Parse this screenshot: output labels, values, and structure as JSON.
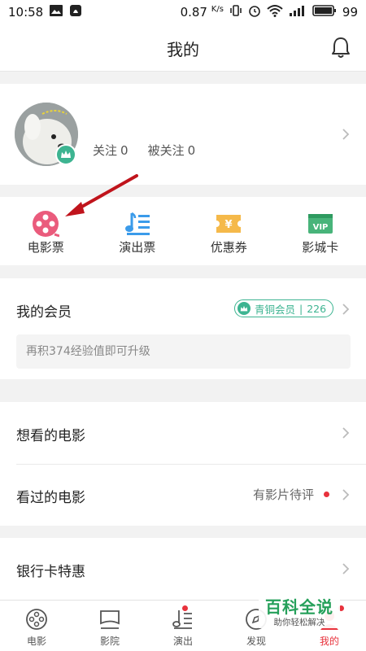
{
  "status_bar": {
    "time": "10:58",
    "speed": "0.87",
    "speed_unit": "K/s",
    "battery": "99"
  },
  "header": {
    "title": "我的"
  },
  "profile": {
    "follow_label": "关注",
    "follow_count": "0",
    "followers_label": "被关注",
    "followers_count": "0"
  },
  "quick_actions": [
    {
      "label": "电影票",
      "icon": "movie-ticket-icon",
      "color": "#ea5b7c"
    },
    {
      "label": "演出票",
      "icon": "show-ticket-icon",
      "color": "#3b9bea"
    },
    {
      "label": "优惠券",
      "icon": "coupon-icon",
      "color": "#f5b94a"
    },
    {
      "label": "影城卡",
      "icon": "vip-card-icon",
      "color": "#48b47a"
    }
  ],
  "membership": {
    "title": "我的会员",
    "level": "青铜会员",
    "points": "226",
    "hint": "再积374经验值即可升级"
  },
  "lists": {
    "want_to_watch": "想看的电影",
    "watched": "看过的电影",
    "pending_review": "有影片待评",
    "bank_card": "银行卡特惠"
  },
  "tabs": [
    {
      "label": "电影",
      "icon": "film-reel-icon",
      "active": false
    },
    {
      "label": "影院",
      "icon": "cinema-screen-icon",
      "active": false
    },
    {
      "label": "演出",
      "icon": "music-note-icon",
      "active": false,
      "dot": true
    },
    {
      "label": "发现",
      "icon": "discover-icon",
      "active": false
    },
    {
      "label": "我的",
      "icon": "profile-icon",
      "active": true,
      "dot": true
    }
  ],
  "watermark": {
    "title": "百科全说",
    "subtitle": "助你轻松解决"
  },
  "colors": {
    "accent": "#e8323c",
    "member_green": "#3db491",
    "active_tab": "#e8323c"
  }
}
